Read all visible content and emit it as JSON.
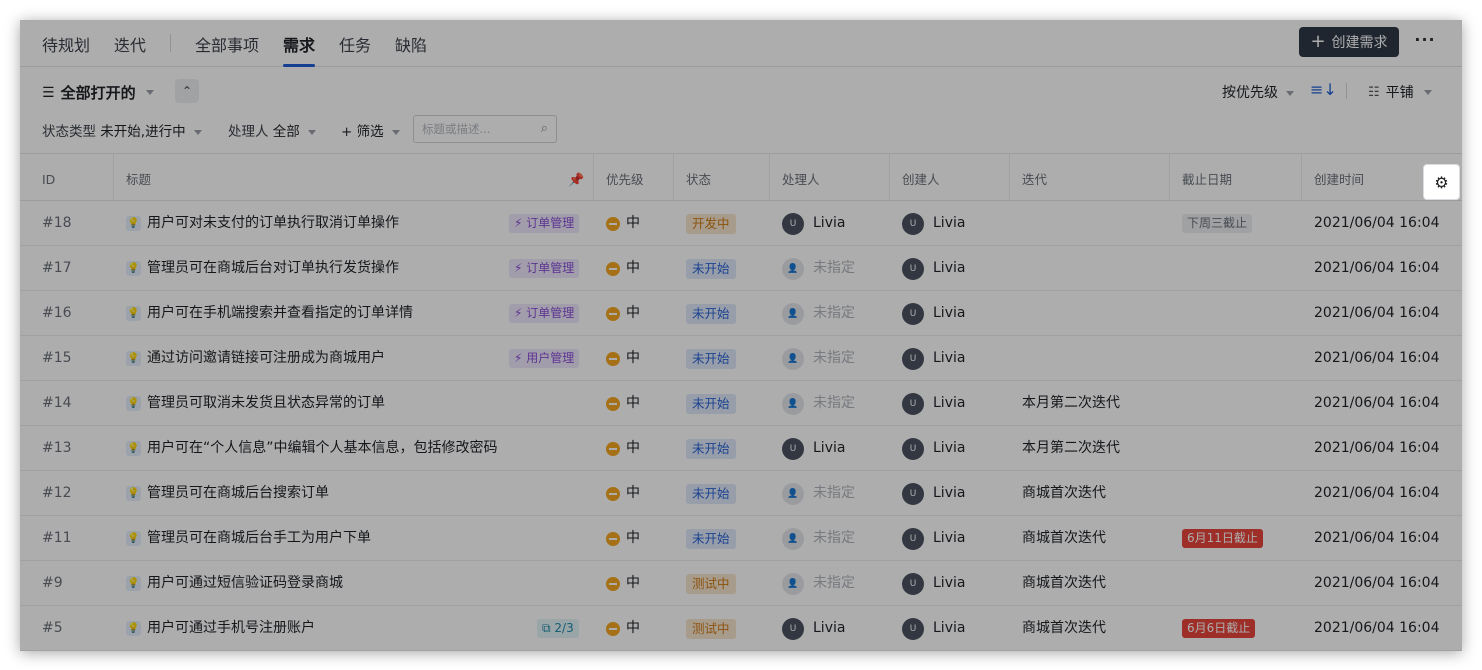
{
  "tabs_left": [
    {
      "label": "待规划"
    },
    {
      "label": "迭代"
    }
  ],
  "tabs_right": [
    {
      "label": "全部事项"
    },
    {
      "label": "需求",
      "active": true
    },
    {
      "label": "任务"
    },
    {
      "label": "缺陷"
    }
  ],
  "header": {
    "create_label": "创建需求",
    "more_label": "···"
  },
  "toolbar": {
    "view_label": "全部打开的",
    "sort_label": "按优先级",
    "layout_label": "平铺",
    "status_filter_label": "状态类型",
    "status_filter_value": "未开始,进行中",
    "assignee_filter_label": "处理人",
    "assignee_filter_value": "全部",
    "add_filter_label": "+ 筛选",
    "search_placeholder": "标题或描述..."
  },
  "columns": [
    "ID",
    "标题",
    "优先级",
    "状态",
    "处理人",
    "创建人",
    "迭代",
    "截止日期",
    "创建时间"
  ],
  "rows": [
    {
      "id": "#18",
      "title": "用户可对未支付的订单执行取消订单操作",
      "tag": "订单管理",
      "tag_type": "epic",
      "priority": "中",
      "status": "开发中",
      "status_color": "#f7e6cf",
      "status_text_color": "#d07a14",
      "assignee": "Livia",
      "assignee_set": true,
      "creator": "Livia",
      "iteration": "",
      "due": "下周三截止",
      "due_type": "grey",
      "created": "2021/06/04 16:04"
    },
    {
      "id": "#17",
      "title": "管理员可在商城后台对订单执行发货操作",
      "tag": "订单管理",
      "tag_type": "epic",
      "priority": "中",
      "status": "未开始",
      "status_color": "#dfe9fb",
      "status_text_color": "#2a63d4",
      "assignee": "未指定",
      "assignee_set": false,
      "creator": "Livia",
      "iteration": "",
      "due": "",
      "due_type": "",
      "created": "2021/06/04 16:04"
    },
    {
      "id": "#16",
      "title": "用户可在手机端搜索并查看指定的订单详情",
      "tag": "订单管理",
      "tag_type": "epic",
      "priority": "中",
      "status": "未开始",
      "status_color": "#dfe9fb",
      "status_text_color": "#2a63d4",
      "assignee": "未指定",
      "assignee_set": false,
      "creator": "Livia",
      "iteration": "",
      "due": "",
      "due_type": "",
      "created": "2021/06/04 16:04"
    },
    {
      "id": "#15",
      "title": "通过访问邀请链接可注册成为商城用户",
      "tag": "用户管理",
      "tag_type": "epic",
      "priority": "中",
      "status": "未开始",
      "status_color": "#dfe9fb",
      "status_text_color": "#2a63d4",
      "assignee": "未指定",
      "assignee_set": false,
      "creator": "Livia",
      "iteration": "",
      "due": "",
      "due_type": "",
      "created": "2021/06/04 16:04"
    },
    {
      "id": "#14",
      "title": "管理员可取消未发货且状态异常的订单",
      "tag": "",
      "tag_type": "",
      "priority": "中",
      "status": "未开始",
      "status_color": "#dfe9fb",
      "status_text_color": "#2a63d4",
      "assignee": "未指定",
      "assignee_set": false,
      "creator": "Livia",
      "iteration": "本月第二次迭代",
      "due": "",
      "due_type": "",
      "created": "2021/06/04 16:04"
    },
    {
      "id": "#13",
      "title": "用户可在“个人信息”中编辑个人基本信息，包括修改密码",
      "tag": "",
      "tag_type": "",
      "priority": "中",
      "status": "未开始",
      "status_color": "#dfe9fb",
      "status_text_color": "#2a63d4",
      "assignee": "Livia",
      "assignee_set": true,
      "creator": "Livia",
      "iteration": "本月第二次迭代",
      "due": "",
      "due_type": "",
      "created": "2021/06/04 16:04"
    },
    {
      "id": "#12",
      "title": "管理员可在商城后台搜索订单",
      "tag": "",
      "tag_type": "",
      "priority": "中",
      "status": "未开始",
      "status_color": "#dfe9fb",
      "status_text_color": "#2a63d4",
      "assignee": "未指定",
      "assignee_set": false,
      "creator": "Livia",
      "iteration": "商城首次迭代",
      "due": "",
      "due_type": "",
      "created": "2021/06/04 16:04"
    },
    {
      "id": "#11",
      "title": "管理员可在商城后台手工为用户下单",
      "tag": "",
      "tag_type": "",
      "priority": "中",
      "status": "未开始",
      "status_color": "#dfe9fb",
      "status_text_color": "#2a63d4",
      "assignee": "未指定",
      "assignee_set": false,
      "creator": "Livia",
      "iteration": "商城首次迭代",
      "due": "6月11日截止",
      "due_type": "red",
      "created": "2021/06/04 16:04"
    },
    {
      "id": "#9",
      "title": "用户可通过短信验证码登录商城",
      "tag": "",
      "tag_type": "",
      "priority": "中",
      "status": "测试中",
      "status_color": "#f7e6cf",
      "status_text_color": "#d07a14",
      "assignee": "未指定",
      "assignee_set": false,
      "creator": "Livia",
      "iteration": "商城首次迭代",
      "due": "",
      "due_type": "",
      "created": "2021/06/04 16:04"
    },
    {
      "id": "#5",
      "title": "用户可通过手机号注册账户",
      "tag": "2/3",
      "tag_type": "sub",
      "priority": "中",
      "status": "测试中",
      "status_color": "#f7e6cf",
      "status_text_color": "#d07a14",
      "assignee": "Livia",
      "assignee_set": true,
      "creator": "Livia",
      "iteration": "商城首次迭代",
      "due": "6月6日截止",
      "due_type": "red",
      "created": "2021/06/04 16:04"
    }
  ]
}
